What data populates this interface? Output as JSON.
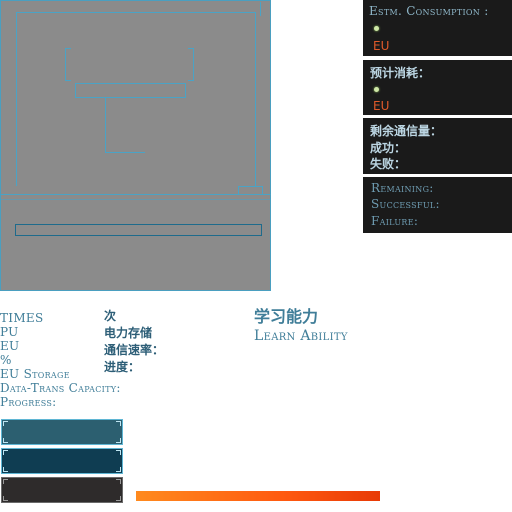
{
  "right_panels": {
    "consumption": {
      "title": "Estm. Consumption :",
      "unit": "EU"
    },
    "consumption_cn": {
      "title": "预计消耗：",
      "unit": "EU"
    },
    "comm_cn": {
      "remaining": "剩余通信量：",
      "success": "成功：",
      "failure": "失败："
    },
    "comm_en": {
      "remaining": "Remaining:",
      "success": "Successful:",
      "failure": "Failure:"
    }
  },
  "labels_en": [
    "TIMES",
    "PU",
    "EU",
    "%",
    "EU Storage",
    "Data-Trans Capacity:",
    "Progress:"
  ],
  "labels_cn": [
    "次",
    "电力存储",
    "通信速率：",
    "进度："
  ],
  "ability": {
    "cn": "学习能力",
    "en": "Learn Ability"
  },
  "colors": {
    "accent": "#4aa3c6",
    "frame_bg": "#8b8b8b",
    "panel_bg": "#1a1a1a",
    "eu_red": "#e05a2a",
    "button_1": "#2c5f70",
    "button_2": "#0f3d52",
    "button_3": "#2e2b2b",
    "progress_start": "#ff8a1e",
    "progress_end": "#e83a06"
  },
  "progress": {
    "value": 1.0
  }
}
